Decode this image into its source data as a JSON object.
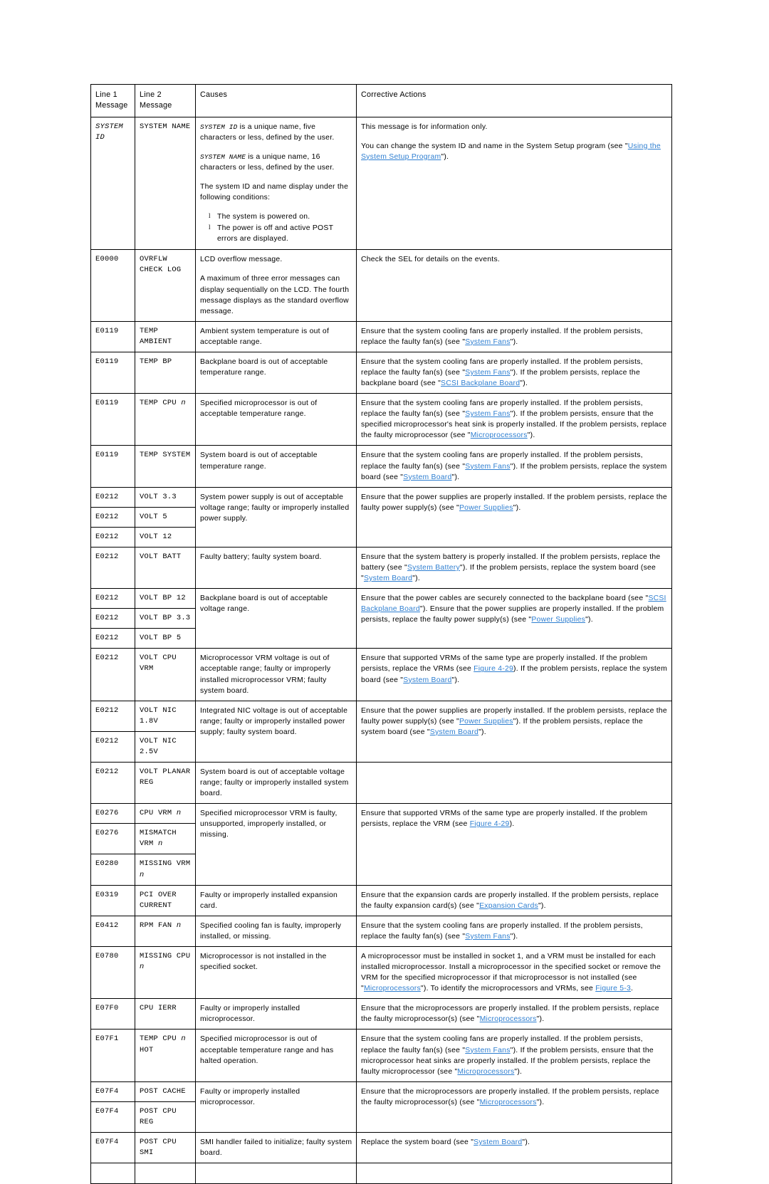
{
  "table": {
    "headers": {
      "line1": "Line 1\nMessage",
      "line2": "Line 2\nMessage",
      "causes": "Causes",
      "actions": "Corrective Actions"
    },
    "link_color": "#2f7fd1",
    "rows": [
      {
        "line1": "SYSTEM ID",
        "line2": "SYSTEM NAME",
        "causes_paras": [
          "SYSTEM ID is a unique name, five characters or less, defined by the user.",
          "SYSTEM NAME is a unique name, 16 characters or less, defined by the user.",
          "The system ID and name display under the following conditions:"
        ],
        "causes_bullets": [
          "The system is powered on.",
          "The power is off and active POST errors are displayed."
        ],
        "actions_paras": [
          "This message is for information only.",
          "You can change the system ID and name in the System Setup program (see \"Using the System Setup Program\")."
        ],
        "actions_links": [
          "Using the System Setup Program"
        ]
      },
      {
        "line1": "E0000",
        "line2": "OVRFLW CHECK LOG",
        "causes_paras": [
          "LCD overflow message.",
          "A maximum of three error messages can display sequentially on the LCD. The fourth message displays as the standard overflow message."
        ],
        "actions_paras": [
          "Check the SEL for details on the events."
        ],
        "actions_links": []
      },
      {
        "line1": "E0119",
        "line2": "TEMP AMBIENT",
        "causes_paras": [
          "Ambient system temperature is out of acceptable range."
        ],
        "actions_paras": [
          "Ensure that the system cooling fans are properly installed. If the problem persists, replace the faulty fan(s) (see \"System Fans\")."
        ],
        "actions_links": [
          "System Fans"
        ]
      },
      {
        "line1": "E0119",
        "line2": "TEMP BP",
        "causes_paras": [
          "Backplane board is out of acceptable temperature range."
        ],
        "actions_paras": [
          "Ensure that the system cooling fans are properly installed. If the problem persists, replace the faulty fan(s) (see \"System Fans\"). If the problem persists, replace the backplane board (see \"SCSI Backplane Board\")."
        ],
        "actions_links": [
          "System Fans",
          "SCSI Backplane Board"
        ]
      },
      {
        "line1": "E0119",
        "line2": "TEMP CPU n",
        "causes_paras": [
          "Specified microprocessor is out of acceptable temperature range."
        ],
        "actions_paras": [
          "Ensure that the system cooling fans are properly installed. If the problem persists, replace the faulty fan(s) (see \"System Fans\"). If the problem persists, ensure that the specified microprocessor's heat sink is properly installed. If the problem persists, replace the faulty microprocessor (see \"Microprocessors\")."
        ],
        "actions_links": [
          "System Fans",
          "Microprocessors"
        ]
      },
      {
        "line1": "E0119",
        "line2": "TEMP SYSTEM",
        "causes_paras": [
          "System board is out of acceptable temperature range."
        ],
        "actions_paras": [
          "Ensure that the system cooling fans are properly installed. If the problem persists, replace the faulty fan(s) (see \"System Fans\"). If the problem persists, replace the system board (see \"System Board\")."
        ],
        "actions_links": [
          "System Fans",
          "System Board"
        ]
      },
      {
        "line1": "E0212",
        "line2": "VOLT 3.3",
        "line2_extra": [
          "VOLT 5",
          "VOLT 12"
        ],
        "line1_extra": [
          "E0212",
          "E0212"
        ],
        "causes_paras": [
          "System power supply is out of acceptable voltage range; faulty or improperly installed power supply."
        ],
        "actions_paras": [
          "Ensure that the power supplies are properly installed. If the problem persists, replace the faulty power supply(s) (see \"Power Supplies\")."
        ],
        "actions_links": [
          "Power Supplies"
        ]
      },
      {
        "line1": "E0212",
        "line2": "VOLT BATT",
        "causes_paras": [
          "Faulty battery; faulty system board."
        ],
        "actions_paras": [
          "Ensure that the system battery is properly installed. If the problem persists, replace the battery (see \"System Battery\"). If the problem persists, replace the system board (see \"System Board\")."
        ],
        "actions_links": [
          "System Battery",
          "System Board"
        ]
      },
      {
        "line1": "E0212",
        "line2": "VOLT BP 12",
        "line2_extra": [
          "VOLT BP 3.3",
          "VOLT BP 5"
        ],
        "line1_extra": [
          "E0212",
          "E0212"
        ],
        "causes_paras": [
          "Backplane board is out of acceptable voltage range."
        ],
        "actions_paras": [
          "Ensure that the power cables are securely connected to the backplane board (see \"SCSI Backplane Board\"). Ensure that the power supplies are properly installed. If the problem persists, replace the faulty power supply(s) (see \"Power Supplies\")."
        ],
        "actions_links": [
          "SCSI Backplane Board",
          "Power Supplies"
        ]
      },
      {
        "line1": "E0212",
        "line2": "VOLT CPU VRM",
        "causes_paras": [
          "Microprocessor VRM voltage is out of acceptable range; faulty or improperly installed microprocessor VRM; faulty system board."
        ],
        "actions_paras": [
          "Ensure that supported VRMs of the same type are properly installed. If the problem persists, replace the VRMs (see Figure 4-29). If the problem persists, replace the system board (see \"System Board\")."
        ],
        "actions_links": [
          "Figure 4-29",
          "System Board"
        ]
      },
      {
        "line1": "E0212",
        "line2": "VOLT NIC 1.8V",
        "line2_extra": [
          "VOLT NIC 2.5V"
        ],
        "line1_extra": [
          "E0212"
        ],
        "causes_paras": [
          "Integrated NIC voltage is out of acceptable range; faulty or improperly installed power supply; faulty system board."
        ],
        "actions_paras": [
          "Ensure that the power supplies are properly installed. If the problem persists, replace the faulty power supply(s) (see \"Power Supplies\"). If the problem persists, replace the system board (see \"System Board\")."
        ],
        "actions_links": [
          "Power Supplies",
          "System Board"
        ]
      },
      {
        "line1": "E0212",
        "line2": "VOLT PLANAR REG",
        "causes_paras": [
          "System board is out of acceptable voltage range; faulty or improperly installed system board."
        ],
        "actions_paras": [],
        "actions_links": []
      },
      {
        "line1": "E0276",
        "line2": "CPU VRM n",
        "line2_extra": [
          "MISMATCH VRM n",
          "MISSING VRM n"
        ],
        "line1_extra": [
          "E0276",
          "E0280"
        ],
        "causes_paras": [
          "Specified microprocessor VRM is faulty, unsupported, improperly installed, or missing."
        ],
        "actions_paras": [
          "Ensure that supported VRMs of the same type are properly installed. If the problem persists, replace the VRM (see Figure 4-29)."
        ],
        "actions_links": [
          "Figure 4-29"
        ]
      },
      {
        "line1": "E0319",
        "line2": "PCI OVER CURRENT",
        "causes_paras": [
          "Faulty or improperly installed expansion card."
        ],
        "actions_paras": [
          "Ensure that the expansion cards are properly installed. If the problem persists, replace the faulty expansion card(s) (see \"Expansion Cards\")."
        ],
        "actions_links": [
          "Expansion Cards"
        ]
      },
      {
        "line1": "E0412",
        "line2": "RPM FAN n",
        "causes_paras": [
          "Specified cooling fan is faulty, improperly installed, or missing."
        ],
        "actions_paras": [
          "Ensure that the system cooling fans are properly installed. If the problem persists, replace the faulty fan(s) (see \"System Fans\")."
        ],
        "actions_links": [
          "System Fans"
        ]
      },
      {
        "line1": "E0780",
        "line2": "MISSING CPU n",
        "causes_paras": [
          "Microprocessor is not installed in the specified socket."
        ],
        "actions_paras": [
          "A microprocessor must be installed in socket 1, and a VRM must be installed for each installed microprocessor. Install a microprocessor in the specified socket or remove the VRM for the specified microprocessor if that microprocessor is not installed (see \"Microprocessors\"). To identify the microprocessors and VRMs, see Figure 5-3."
        ],
        "actions_links": [
          "Microprocessors",
          "Figure 5-3"
        ]
      },
      {
        "line1": "E07F0",
        "line2": "CPU IERR",
        "causes_paras": [
          "Faulty or improperly installed microprocessor."
        ],
        "actions_paras": [
          "Ensure that the microprocessors are properly installed. If the problem persists, replace the faulty microprocessor(s) (see \"Microprocessors\")."
        ],
        "actions_links": [
          "Microprocessors"
        ]
      },
      {
        "line1": "E07F1",
        "line2": "TEMP CPU n HOT",
        "causes_paras": [
          "Specified microprocessor is out of acceptable temperature range and has halted operation."
        ],
        "actions_paras": [
          "Ensure that the system cooling fans are properly installed. If the problem persists, replace the faulty fan(s) (see \"System Fans\"). If the problem persists, ensure that the microprocessor heat sinks are properly installed. If the problem persists, replace the faulty microprocessor (see \"Microprocessors\")."
        ],
        "actions_links": [
          "System Fans",
          "Microprocessors"
        ]
      },
      {
        "line1": "E07F4",
        "line2": "POST CACHE",
        "line2_extra": [
          "POST CPU REG"
        ],
        "line1_extra": [
          "E07F4"
        ],
        "causes_paras": [
          "Faulty or improperly installed microprocessor."
        ],
        "actions_paras": [
          "Ensure that the microprocessors are properly installed. If the problem persists, replace the faulty microprocessor(s) (see \"Microprocessors\")."
        ],
        "actions_links": [
          "Microprocessors"
        ]
      },
      {
        "line1": "E07F4",
        "line2": "POST CPU SMI",
        "causes_paras": [
          "SMI handler failed to initialize; faulty system board."
        ],
        "actions_paras": [
          "Replace the system board (see \"System Board\")."
        ],
        "actions_links": [
          "System Board"
        ]
      }
    ]
  }
}
